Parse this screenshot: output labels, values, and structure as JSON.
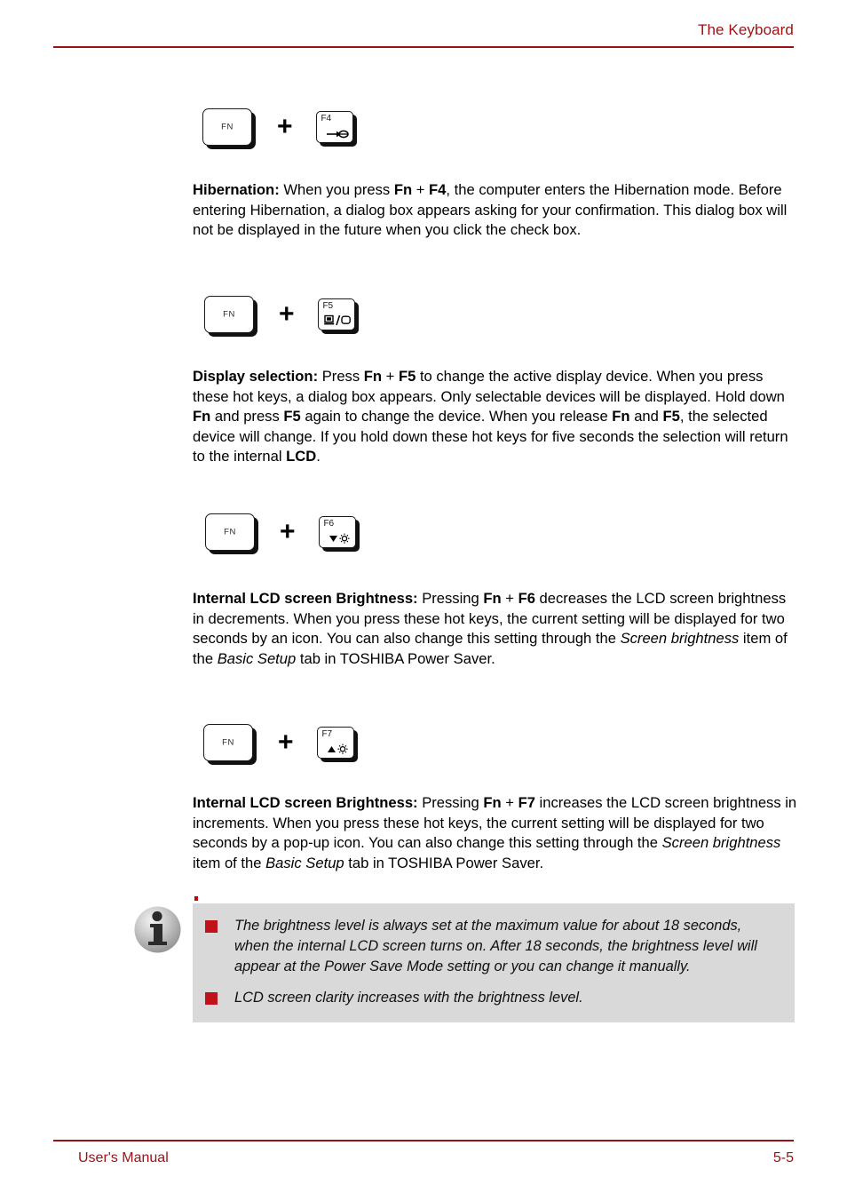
{
  "header": {
    "title": "The Keyboard",
    "rule_color": "#9e1014"
  },
  "footer": {
    "left": "User's Manual",
    "right": "5-5",
    "rule_color": "#9e1014"
  },
  "sections": [
    {
      "combo": {
        "modifier_key_label": "FN",
        "plus": "+",
        "function_key_label": "F4",
        "function_key_icon": "hibernation-arrow-into-disk-icon"
      },
      "paragraph_html": "<b>Hibernation:</b> When you press <b>Fn</b> + <b>F4</b>, the computer enters the Hibernation mode. Before entering Hibernation, a dialog box appears asking for your confirmation. This dialog box will not be displayed in the future when you click the check box."
    },
    {
      "combo": {
        "modifier_key_label": "FN",
        "plus": "+",
        "function_key_label": "F5",
        "function_key_icon": "display-selection-monitor-slash-panel-icon"
      },
      "paragraph_html": "<b>Display selection:</b> Press <b>Fn</b> + <b>F5</b> to change the active display device. When you press these hot keys, a dialog box appears. Only selectable devices will be displayed. Hold down <b>Fn</b> and press <b>F5</b> again to change the device. When you release <b>Fn</b> and <b>F5</b>, the selected device will change. If you hold down these hot keys for five seconds the selection will return to the internal <b>LCD</b>."
    },
    {
      "combo": {
        "modifier_key_label": "FN",
        "plus": "+",
        "function_key_label": "F6",
        "function_key_icon": "brightness-down-triangle-sun-icon"
      },
      "paragraph_html": "<b>Internal LCD screen Brightness:</b> Pressing <b>Fn</b> + <b>F6</b> decreases the LCD screen brightness in decrements. When you press these hot keys, the current setting will be displayed for two seconds by an icon. You can also change this setting through the <i>Screen brightness</i> item of the <i>Basic Setup</i> tab in TOSHIBA Power Saver."
    },
    {
      "combo": {
        "modifier_key_label": "FN",
        "plus": "+",
        "function_key_label": "F7",
        "function_key_icon": "brightness-up-triangle-sun-icon"
      },
      "paragraph_html": "<b>Internal LCD screen Brightness:</b> Pressing <b>Fn</b> + <b>F7</b> increases the LCD screen brightness in increments. When you press these hot keys, the current setting will be displayed for two seconds by a pop-up icon. You can also change this setting through the <i>Screen brightness</i> item of the <i>Basic Setup</i> tab in TOSHIBA Power Saver."
    }
  ],
  "note": {
    "icon": "info-icon",
    "background_color": "#d9d9d9",
    "bullet_color": "#c1121c",
    "items": [
      "The brightness level is always set at the maximum value for about 18 seconds, when the internal LCD screen turns on. After 18 seconds, the brightness level will appear at the Power Save Mode setting or you can change it manually.",
      "LCD screen clarity increases with the brightness level."
    ]
  }
}
